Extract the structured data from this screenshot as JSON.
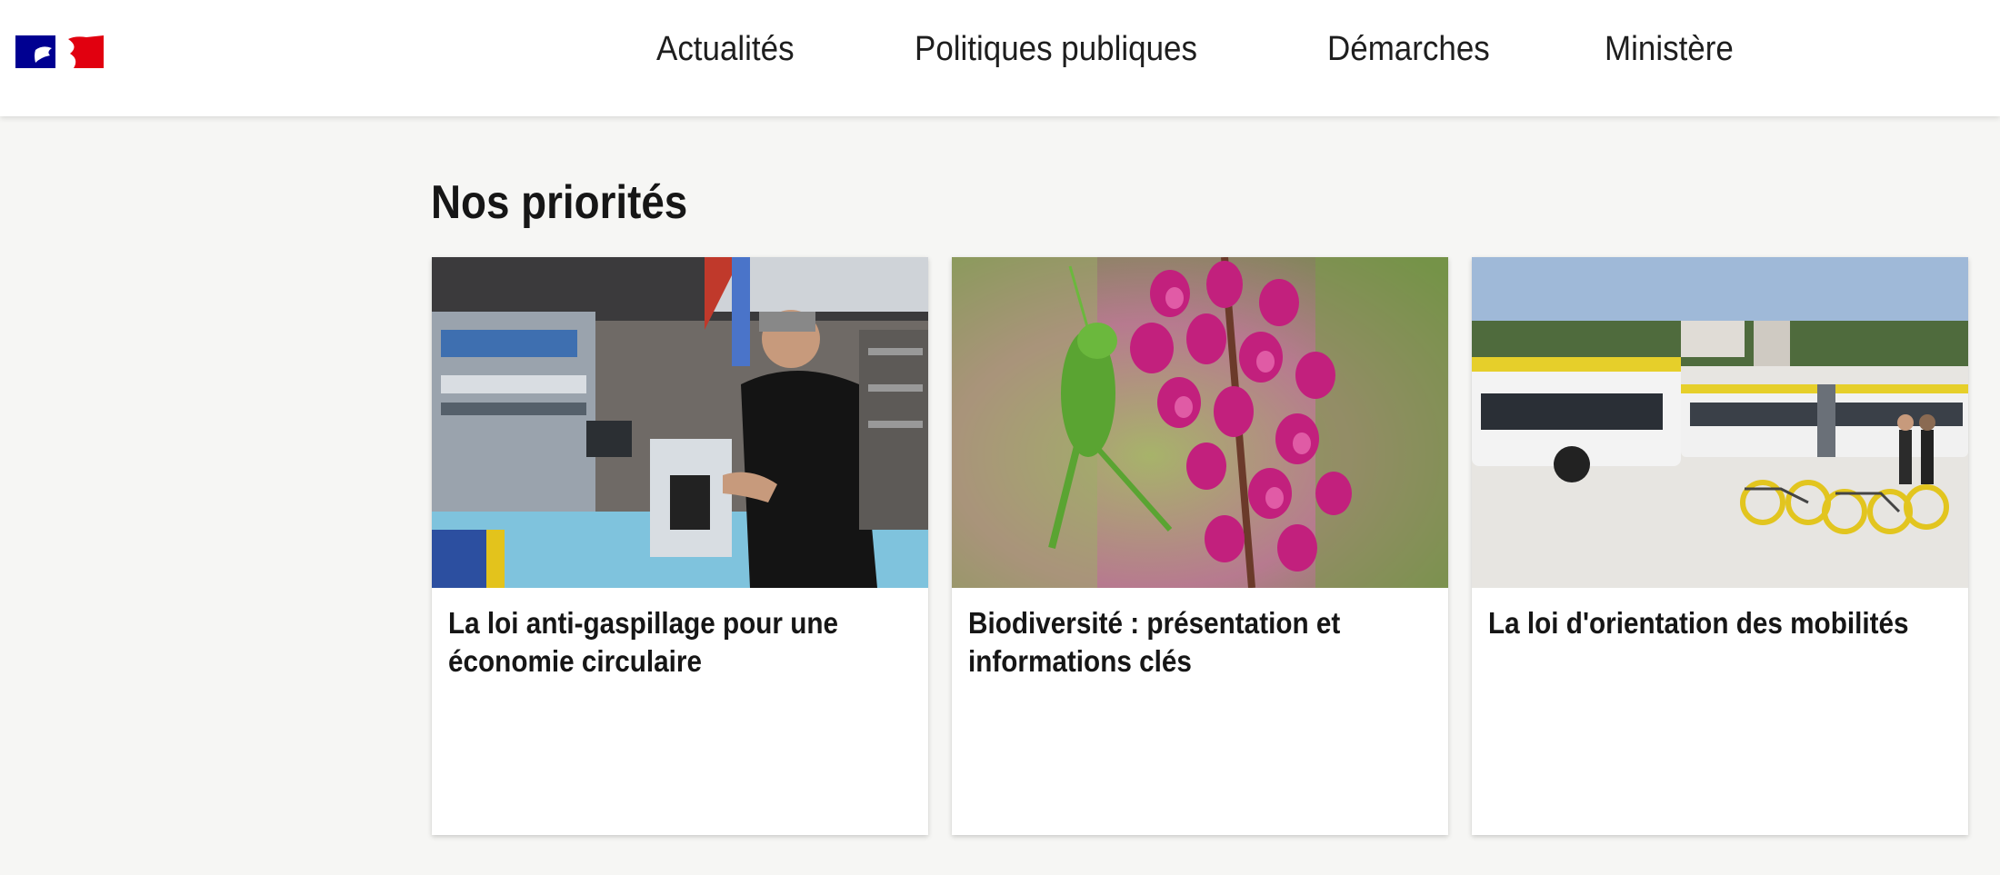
{
  "header": {
    "logo_name": "republique-francaise-logo",
    "nav": [
      {
        "label": "Actualités"
      },
      {
        "label": "Politiques publiques"
      },
      {
        "label": "Démarches"
      },
      {
        "label": "Ministère"
      }
    ]
  },
  "main": {
    "section_title": "Nos priorités",
    "cards": [
      {
        "title": "La loi anti-gaspillage pour une économie circulaire",
        "image": "factory-worker-photo"
      },
      {
        "title": "Biodiversité : présentation et informations clés",
        "image": "grasshopper-flower-photo"
      },
      {
        "title": "La loi d'orientation des mobilités",
        "image": "tram-bikes-photo"
      }
    ]
  },
  "colors": {
    "blue": "#000091",
    "red": "#e1000f",
    "background": "#f6f6f4"
  }
}
